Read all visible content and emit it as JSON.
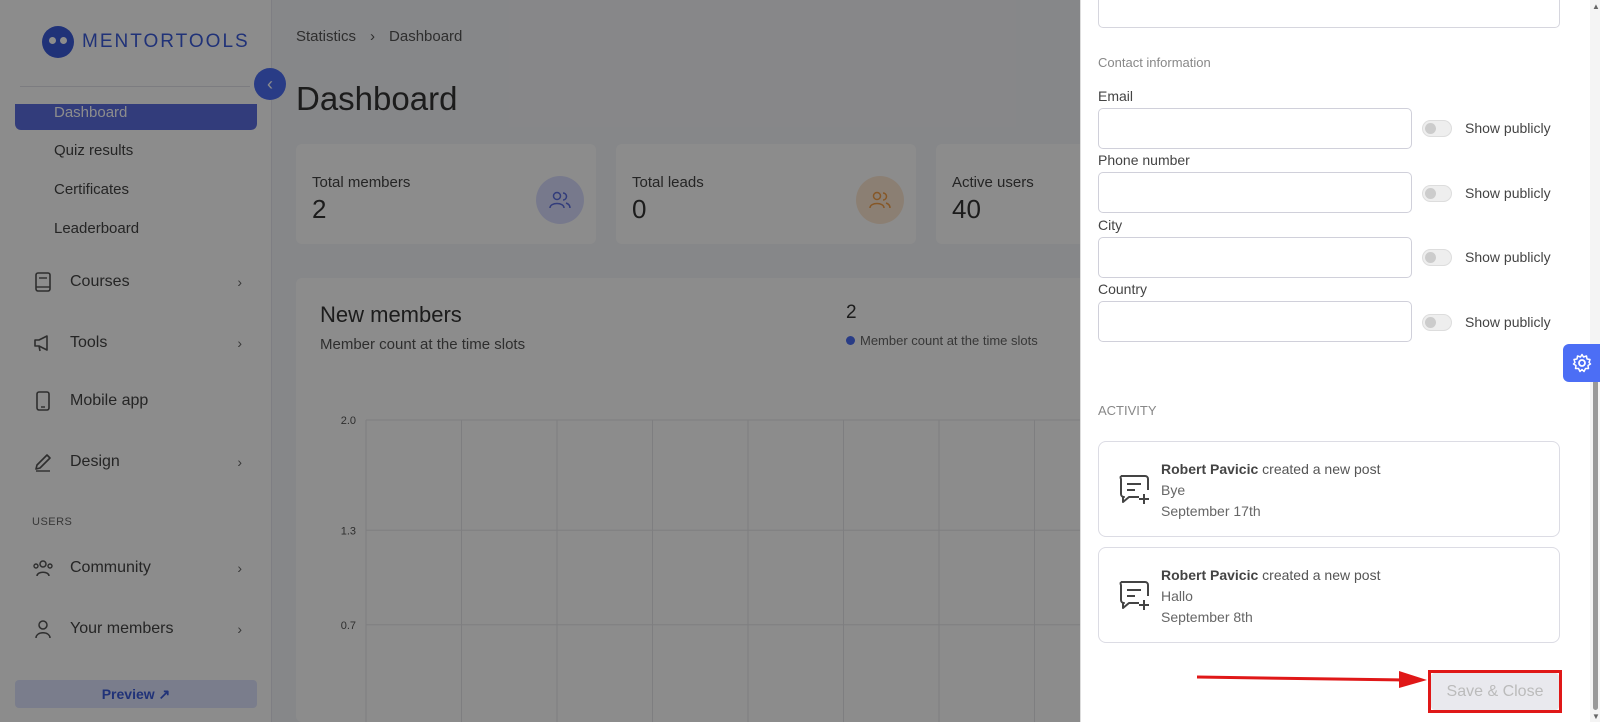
{
  "sidebar": {
    "logo": "MENTORTOOLS",
    "active_item": "Dashboard",
    "sub_items": [
      "Quiz results",
      "Certificates",
      "Leaderboard"
    ],
    "items": [
      {
        "label": "Courses",
        "icon": "book-icon",
        "chevron": true
      },
      {
        "label": "Tools",
        "icon": "megaphone-icon",
        "chevron": true
      },
      {
        "label": "Mobile app",
        "icon": "phone-icon",
        "chevron": false
      },
      {
        "label": "Design",
        "icon": "pencil-icon",
        "chevron": true
      }
    ],
    "users_section": "USERS",
    "user_items": [
      {
        "label": "Community",
        "icon": "community-icon"
      },
      {
        "label": "Your members",
        "icon": "person-icon"
      }
    ],
    "preview_label": "Preview ↗"
  },
  "main": {
    "breadcrumb": [
      "Statistics",
      "Dashboard"
    ],
    "title": "Dashboard",
    "stats": [
      {
        "label": "Total members",
        "value": "2",
        "icon": "users-icon",
        "color": "#5b6ee0"
      },
      {
        "label": "Total leads",
        "value": "0",
        "icon": "users-icon",
        "color": "#f59f47"
      },
      {
        "label": "Active users",
        "value": "40",
        "icon": "",
        "color": ""
      }
    ],
    "chart_card": {
      "title": "New members",
      "subtitle": "Member count at the time slots",
      "total": "2",
      "legend": "Member count at the time slots"
    }
  },
  "chart_data": {
    "type": "line",
    "title": "New members",
    "subtitle": "Member count at the time slots",
    "yticks": [
      "2.0",
      "1.3",
      "0.7"
    ],
    "ylim": [
      0,
      2.0
    ],
    "grid": true,
    "legend": "top-right",
    "series": [
      {
        "name": "Member count at the time slots",
        "values": []
      }
    ]
  },
  "panel": {
    "contact_section": "Contact information",
    "fields": [
      {
        "label": "Email",
        "value": "",
        "toggle_label": "Show publicly"
      },
      {
        "label": "Phone number",
        "value": "",
        "toggle_label": "Show publicly"
      },
      {
        "label": "City",
        "value": "",
        "toggle_label": "Show publicly"
      },
      {
        "label": "Country",
        "value": "",
        "toggle_label": "Show publicly"
      }
    ],
    "activity_section": "ACTIVITY",
    "activities": [
      {
        "name": "Robert Pavicic",
        "action": "created a new post",
        "post": "Bye",
        "date": "September 17th"
      },
      {
        "name": "Robert Pavicic",
        "action": "created a new post",
        "post": "Hallo",
        "date": "September 8th"
      }
    ],
    "save_label": "Save & Close"
  },
  "colors": {
    "accent": "#4c6ef5",
    "highlight": "#e01818"
  }
}
